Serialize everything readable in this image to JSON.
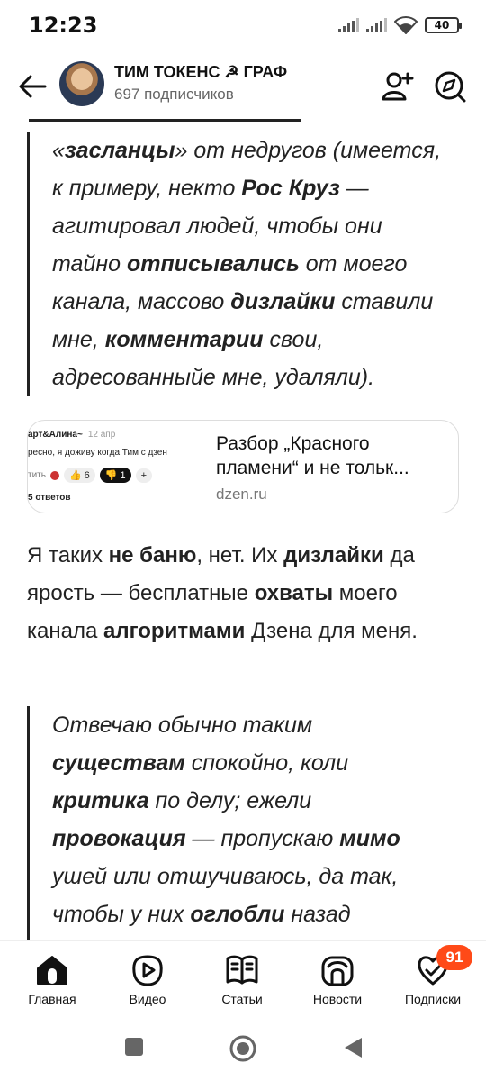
{
  "status_bar": {
    "time": "12:23",
    "battery": "40",
    "icons": [
      "signal-icon",
      "signal-icon",
      "wifi-icon",
      "battery-icon"
    ]
  },
  "header": {
    "channel_title": "ТИМ ТОКЕНС ☭ ГРАФ",
    "subscribers": "697 подписчиков",
    "icons": [
      "back-arrow-icon",
      "add-user-icon",
      "compass-icon"
    ]
  },
  "article": {
    "quote1_html": "«<b>засланцы</b>» от недругов (имеется, к примеру, некто <b>Рос Круз</b> — агитировал людей, чтобы они тайно <b>отписывались</b> от моего канала, массово <b>дизлайки</b> ставили мне, <b>комментарии</b> свои, адресованныйе мне, удаляли).",
    "link_card": {
      "thumb_author": "арт&Алина~",
      "thumb_date": "12 апр",
      "thumb_text": "ресно, я доживу когда Тим с дзен",
      "thumb_action": "тить",
      "thumb_like": "6",
      "thumb_dislike": "1",
      "thumb_replies": "5 ответов",
      "title": "Разбор „Красного пламени“ и не тольк...",
      "domain": "dzen.ru"
    },
    "para_html": "Я таких <b>не баню</b>, нет. Их <b>дизлайки</b> да ярость — бесплатные <b>охваты</b> моего канала <b>алгоритмами</b> Дзена для меня.",
    "quote2_html": "Отвечаю обычно таким <b>существам</b> спокойно, коли <b>критика</b> по делу; ежели <b>провокация</b> — пропускаю <b>мимо</b> ушей или отшучиваюсь, да так, чтобы у них <b>оглобли</b> назад загнулись."
  },
  "bottom_nav": {
    "items": [
      {
        "label": "Главная",
        "icon": "home-icon"
      },
      {
        "label": "Видео",
        "icon": "video-icon"
      },
      {
        "label": "Статьи",
        "icon": "articles-icon"
      },
      {
        "label": "Новости",
        "icon": "news-icon"
      },
      {
        "label": "Подписки",
        "icon": "subscriptions-icon",
        "badge": "91"
      }
    ]
  },
  "system_nav": {
    "icons": [
      "recents-square-icon",
      "home-circle-icon",
      "back-triangle-icon"
    ]
  },
  "colors": {
    "badge": "#ff4a18",
    "text": "#222222",
    "muted": "#666666"
  }
}
